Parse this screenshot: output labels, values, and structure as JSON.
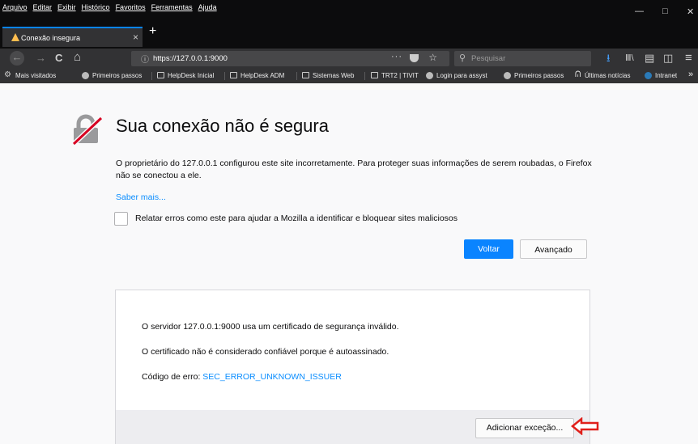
{
  "menubar": {
    "items": [
      "Arquivo",
      "Editar",
      "Exibir",
      "Histórico",
      "Favoritos",
      "Ferramentas",
      "Ajuda"
    ],
    "minimize": "—",
    "maximize": "□",
    "close": "✕"
  },
  "tab": {
    "title": "Conexão insegura",
    "close": "×",
    "new_tab": "+"
  },
  "navbar": {
    "back": "←",
    "forward": "→",
    "reload": "C",
    "home": "⌂",
    "info": "ⓘ",
    "url": "https://127.0.0.1:9000",
    "page_actions": "···",
    "bookmark_star": "☆",
    "search_placeholder": "Pesquisar",
    "search_glyph": "⚲",
    "download": "⭳",
    "library": "Ⅲ\\",
    "print": "▤",
    "sidebar": "◫",
    "menu": "≡"
  },
  "bookmarks": {
    "settings_glyph": "⚙",
    "items": [
      "Mais visitados",
      "Primeiros passos",
      "HelpDesk Inicial",
      "HelpDesk ADM",
      "Sistemas Web",
      "TRT2 | TIVIT",
      "Login para assyst",
      "Primeiros passos",
      "Últimas notícias",
      "Intranet"
    ],
    "rss_glyph": "ᕬ",
    "overflow": "»"
  },
  "error_page": {
    "title": "Sua conexão não é segura",
    "description": "O proprietário do 127.0.0.1 configurou este site incorretamente. Para proteger suas informações de serem roubadas, o Firefox não se conectou a ele.",
    "learn_more": "Saber mais...",
    "report_label": "Relatar erros como este para ajudar a Mozilla a identificar e bloquear sites maliciosos",
    "back_button": "Voltar",
    "advanced_button": "Avançado"
  },
  "advanced_panel": {
    "line1": "O servidor 127.0.0.1:9000 usa um certificado de segurança inválido.",
    "line2": "O certificado não é considerado confiável porque é autoassinado.",
    "error_code_label": "Código de erro: ",
    "error_code": "SEC_ERROR_UNKNOWN_ISSUER",
    "add_exception_button": "Adicionar exceção..."
  },
  "colors": {
    "accent": "#0a84ff",
    "link": "#0a8dff",
    "warning": "#ffbd4f",
    "annotation_arrow": "#e0201b"
  }
}
